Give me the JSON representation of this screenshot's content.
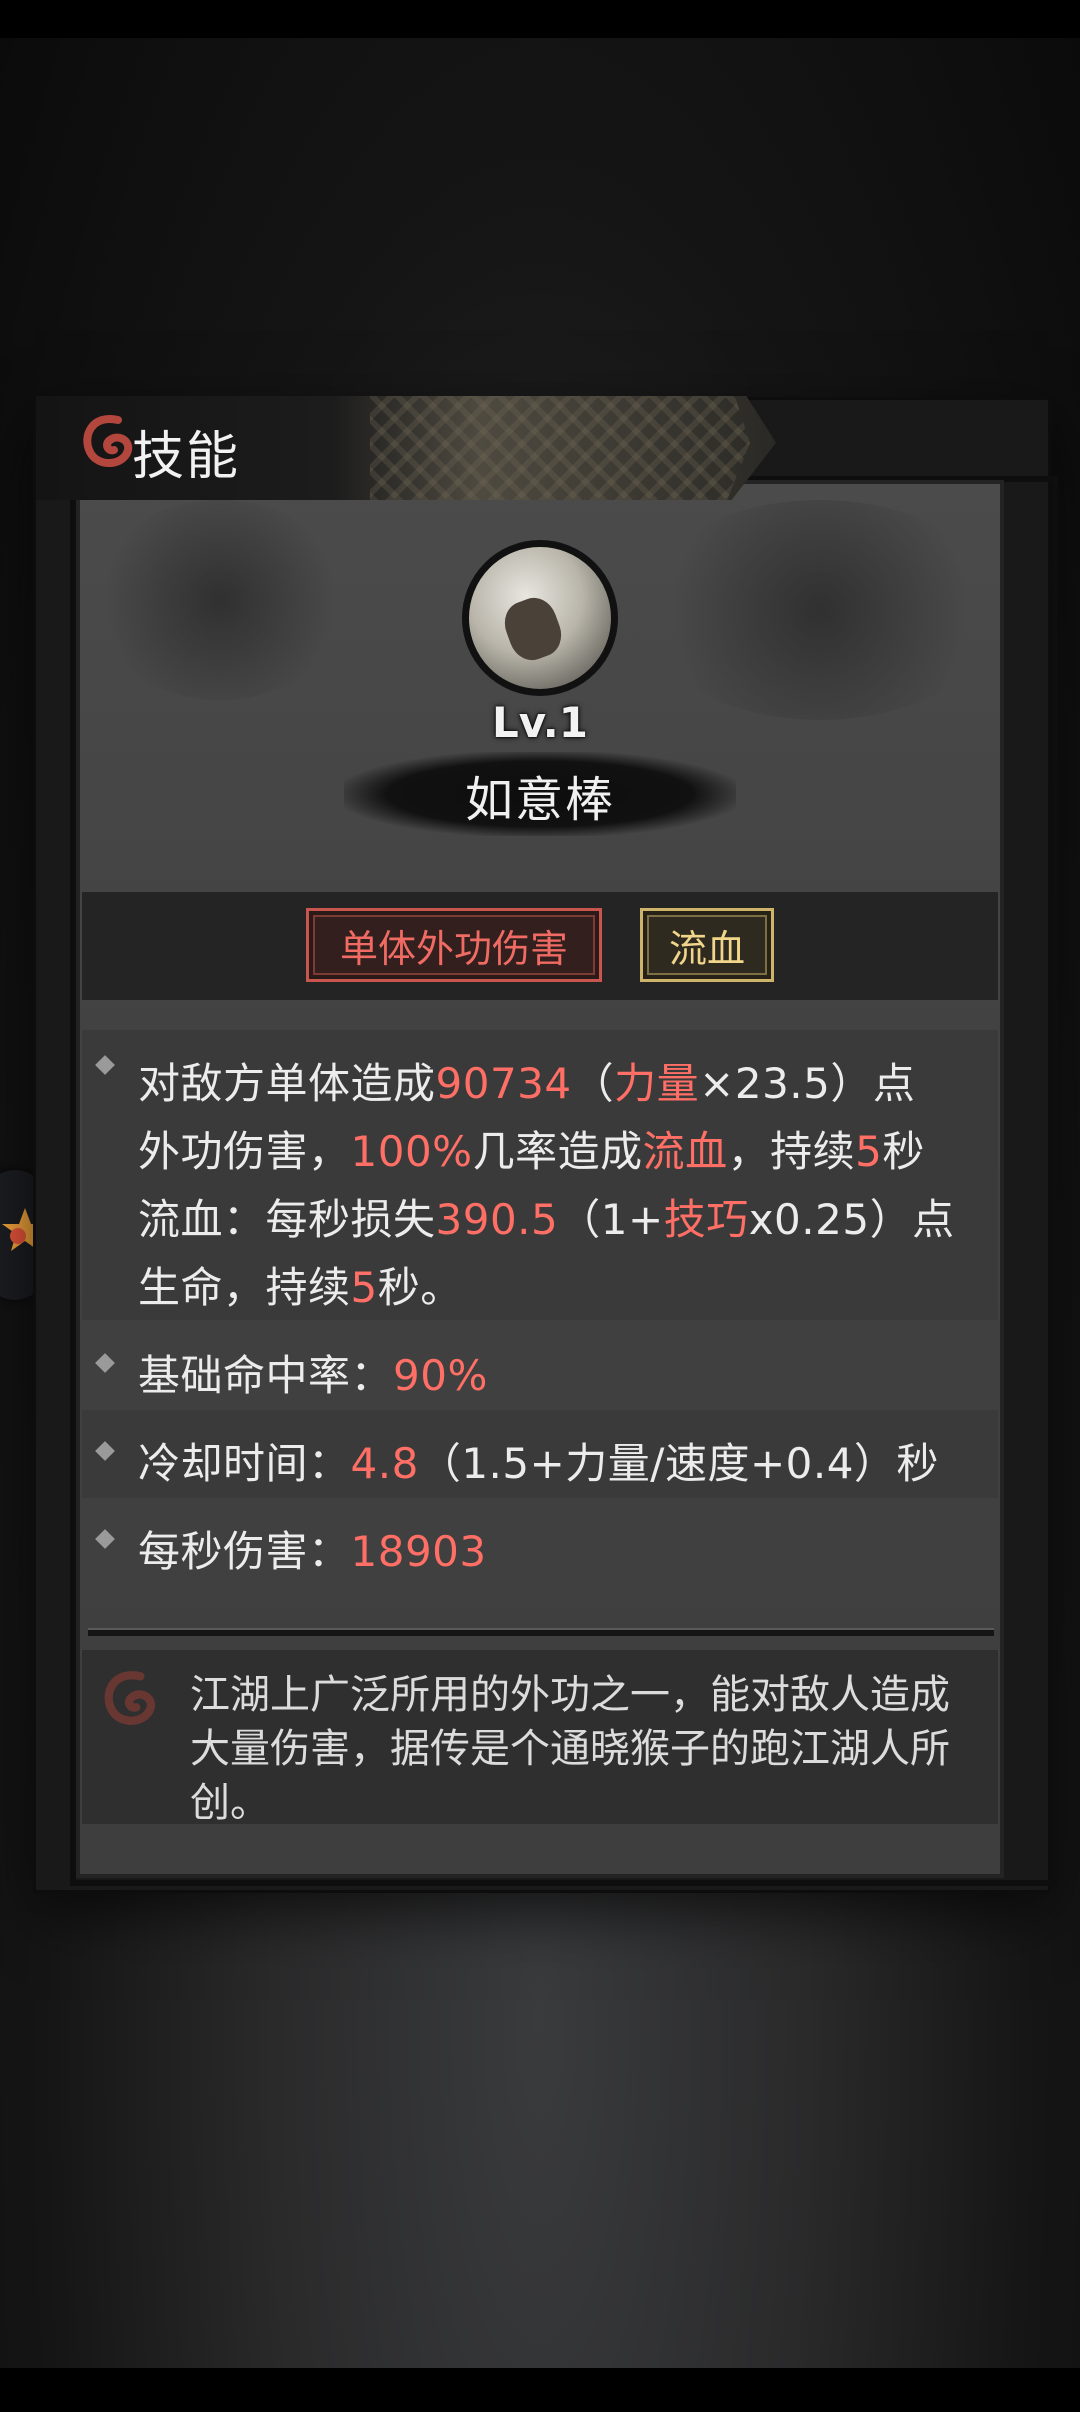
{
  "panel": {
    "title": "技能"
  },
  "skill": {
    "level": "Lv.1",
    "name": "如意棒",
    "tags": [
      "单体外功伤害",
      "流血"
    ]
  },
  "description": {
    "line1": {
      "t1": "对敌方单体造成",
      "v1": "90734",
      "t2": "（",
      "v2": "力量",
      "t3": "×23.5）点"
    },
    "line2": {
      "t1": "外功伤害，",
      "v1": "100%",
      "t2": "几率造成",
      "v2": "流血",
      "t3": "，持续",
      "v3": "5",
      "t4": "秒"
    },
    "line3": {
      "t1": "流血：每秒损失",
      "v1": "390.5",
      "t2": "（1+",
      "v2": "技巧",
      "t3": "x0.25）点"
    },
    "line4": {
      "t1": "生命，持续",
      "v1": "5",
      "t2": "秒。"
    }
  },
  "stats": {
    "hit_rate": {
      "label": "基础命中率：",
      "value": "90%"
    },
    "cooldown": {
      "label": "冷却时间：",
      "value": "4.8",
      "formula": "（1.5+力量/速度+0.4）秒"
    },
    "dps": {
      "label": "每秒伤害：",
      "value": "18903"
    }
  },
  "lore": {
    "line1": "江湖上广泛所用的外功之一，能对敌人造成",
    "line2": "大量伤害，据传是个通晓猴子的跑江湖人所",
    "line3": "创。"
  },
  "colors": {
    "highlight": "#ff6f66",
    "tag_red": "#f06b63",
    "tag_gold": "#f0d58a"
  }
}
